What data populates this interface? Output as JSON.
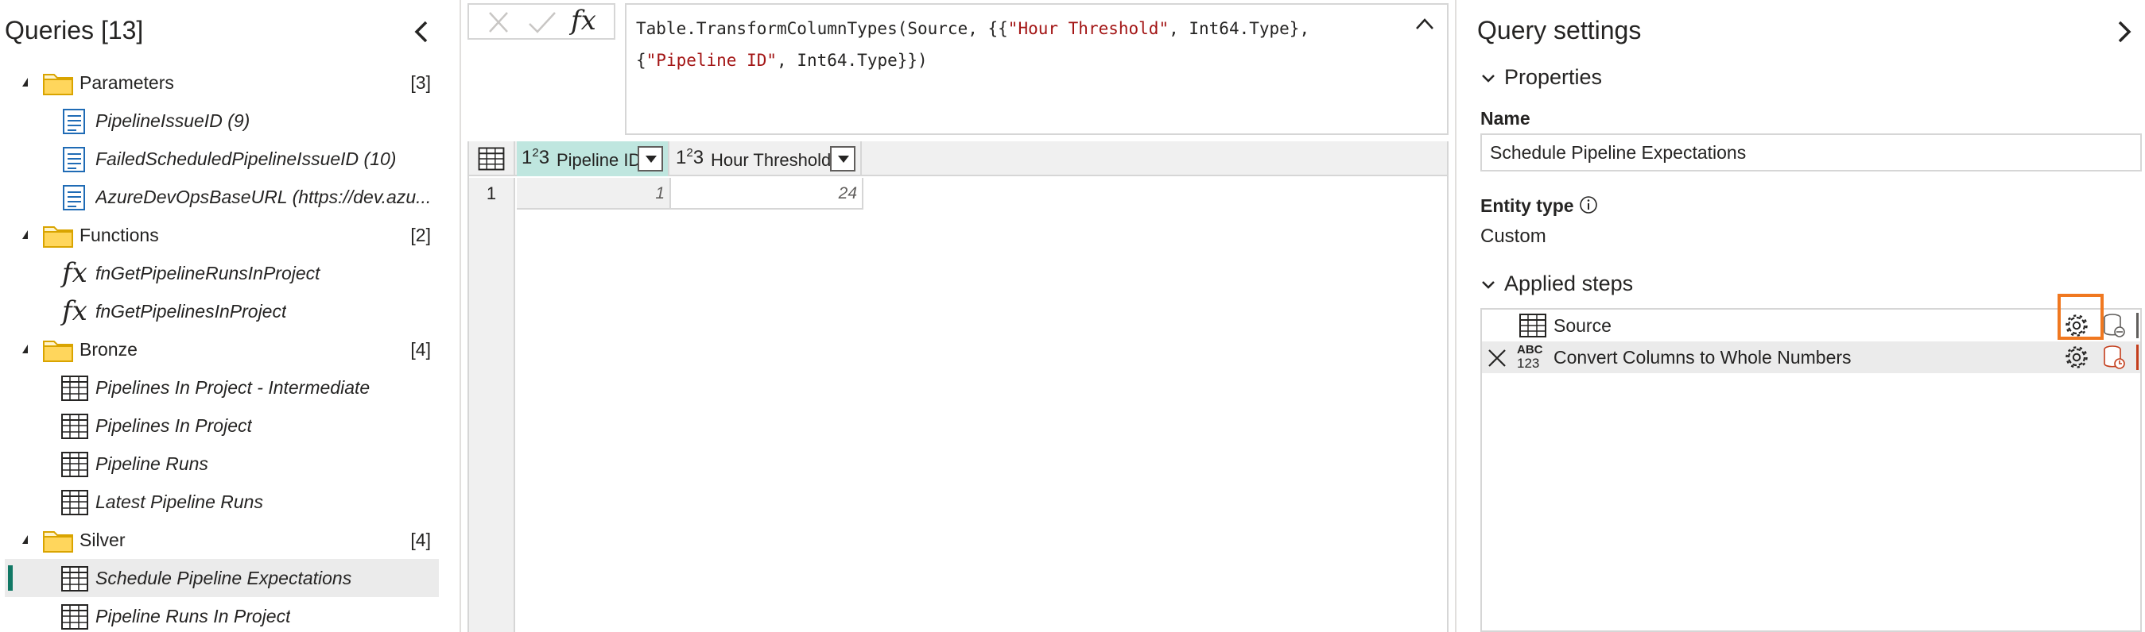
{
  "queries_pane": {
    "title": "Queries [13]",
    "groups": [
      {
        "label": "Parameters",
        "count": "[3]",
        "items": [
          {
            "label": "PipelineIssueID (9)",
            "icon": "parameter-icon"
          },
          {
            "label": "FailedScheduledPipelineIssueID (10)",
            "icon": "parameter-icon"
          },
          {
            "label": "AzureDevOpsBaseURL (https://dev.azu...",
            "icon": "parameter-icon"
          }
        ]
      },
      {
        "label": "Functions",
        "count": "[2]",
        "items": [
          {
            "label": "fnGetPipelineRunsInProject",
            "icon": "function-icon"
          },
          {
            "label": "fnGetPipelinesInProject",
            "icon": "function-icon"
          }
        ]
      },
      {
        "label": "Bronze",
        "count": "[4]",
        "items": [
          {
            "label": "Pipelines In Project - Intermediate",
            "icon": "table-icon"
          },
          {
            "label": "Pipelines In Project",
            "icon": "table-icon"
          },
          {
            "label": "Pipeline Runs",
            "icon": "table-icon"
          },
          {
            "label": "Latest Pipeline Runs",
            "icon": "table-icon"
          }
        ]
      },
      {
        "label": "Silver",
        "count": "[4]",
        "items": [
          {
            "label": "Schedule Pipeline Expectations",
            "icon": "table-icon",
            "selected": true
          },
          {
            "label": "Pipeline Runs In Project",
            "icon": "table-icon"
          }
        ]
      }
    ],
    "fx_symbol": "fx"
  },
  "formula_bar": {
    "fx_label": "fx",
    "line1_a": "Table.TransformColumnTypes(Source, {{",
    "line1_str": "\"Hour Threshold\"",
    "line1_b": ", Int64.Type},",
    "line2_a": "{",
    "line2_str": "\"Pipeline ID\"",
    "line2_b": ", Int64.Type}})"
  },
  "grid": {
    "columns": [
      {
        "type": "123",
        "name": "Pipeline ID",
        "active": true
      },
      {
        "type": "123",
        "name": "Hour Threshold",
        "active": false
      }
    ],
    "rows": [
      {
        "num": "1",
        "cells": [
          "1",
          "24"
        ]
      }
    ]
  },
  "settings": {
    "title": "Query settings",
    "properties_label": "Properties",
    "name_label": "Name",
    "name_value": "Schedule Pipeline Expectations",
    "entity_type_label": "Entity type",
    "entity_type_value": "Custom",
    "applied_steps_label": "Applied steps",
    "steps": [
      {
        "label": "Source",
        "icon": "table-icon",
        "deletable": false
      },
      {
        "label": "Convert Columns to Whole Numbers",
        "icon": "abc-123-icon",
        "abc": "ABC",
        "num": "123",
        "deletable": true,
        "selected": true
      }
    ]
  },
  "colors": {
    "accent_teal": "#117865",
    "active_column": "#bfe6df",
    "highlight_orange": "#f07820",
    "string_red": "#a31515",
    "step_warning": "#c43e1c"
  }
}
